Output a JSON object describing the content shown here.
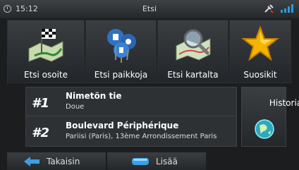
{
  "statusbar": {
    "time": "15:12",
    "title": "Etsi",
    "icons": [
      "clock-icon",
      "satellite-icon",
      "signal-icon"
    ]
  },
  "tiles": [
    {
      "label": "Etsi osoite",
      "icon": "checkered-flag-map-icon"
    },
    {
      "label": "Etsi paikkoja",
      "icon": "poi-pins-icon"
    },
    {
      "label": "Etsi kartalta",
      "icon": "map-magnifier-icon"
    },
    {
      "label": "Suosikit",
      "icon": "star-icon"
    }
  ],
  "recent": [
    {
      "rank": "#1",
      "name": "Nimetön tie",
      "sub": "Doue"
    },
    {
      "rank": "#2",
      "name": "Boulevard Périphérique",
      "sub": "Pariisi (Paris), 13ème Arrondissement Paris"
    }
  ],
  "history": {
    "label": "Historia",
    "icon": "globe-icon"
  },
  "bottom": {
    "back_label": "Takaisin",
    "more_label": "Lisää",
    "back_icon": "back-arrow-icon",
    "more_icon": "more-icon"
  },
  "colors": {
    "accent_green": "#2fa32f",
    "star": "#f5b400",
    "arrow_blue": "#3aa0e6"
  }
}
